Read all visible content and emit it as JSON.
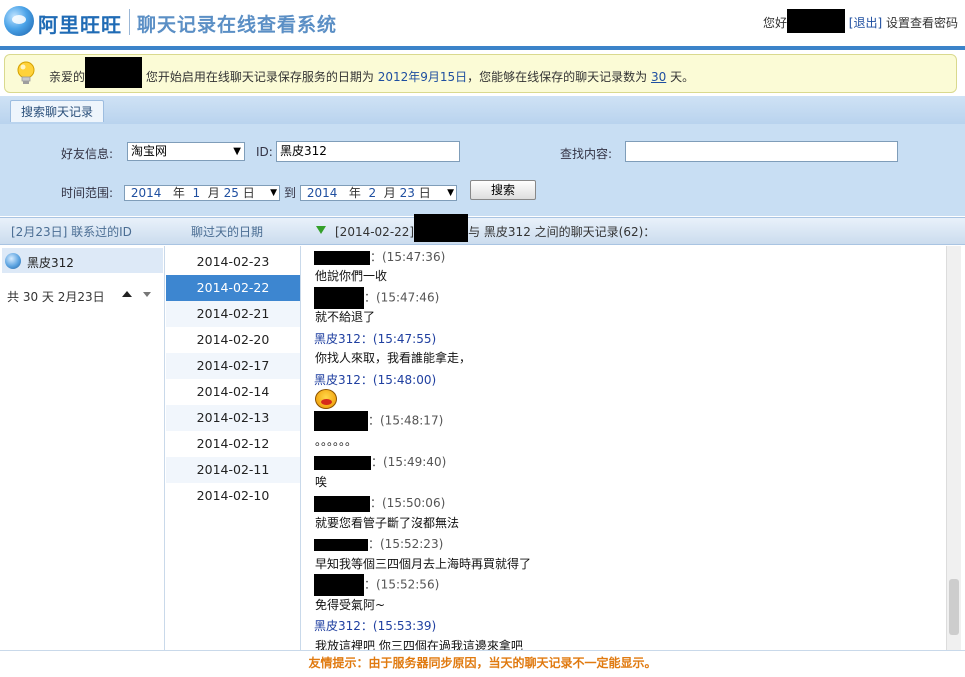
{
  "header": {
    "logo_text": "阿里旺旺",
    "system_title": "聊天记录在线查看系统",
    "greeting": "您好",
    "logout_label": "[退出]",
    "set_password_label": "设置查看密码"
  },
  "notice": {
    "prefix": "亲爱的",
    "text_a": "您开始启用在线聊天记录保存服务的日期为",
    "start_date": "2012年9月15日",
    "text_b": "，您能够在线保存的聊天记录数为",
    "days": "30",
    "text_c": "天。"
  },
  "toolbar": {
    "tab_search": "搜索聊天记录"
  },
  "form": {
    "friend_label": "好友信息:",
    "friend_select": "淘宝网",
    "id_label": "ID:",
    "id_value": "黑皮312",
    "content_label": "查找内容:",
    "content_value": "",
    "time_label": "时间范围:",
    "from": {
      "year": "2014",
      "month": "1",
      "day": "25"
    },
    "to_label": "到",
    "to": {
      "year": "2014",
      "month": "2",
      "day": "23"
    },
    "year_unit": "年",
    "month_unit": "月",
    "day_unit": "日",
    "search_button": "搜索"
  },
  "columns": {
    "contacts_title": "[2月23日] 联系过的ID",
    "dates_title": "聊过天的日期",
    "chat_title_date": "[2014-02-22]",
    "chat_title_rest": "与 黑皮312 之间的聊天记录(62)："
  },
  "contacts": {
    "name": "黑皮312",
    "count_text": "共 30 天 2月23日"
  },
  "dates": [
    "2014-02-23",
    "2014-02-22",
    "2014-02-21",
    "2014-02-20",
    "2014-02-17",
    "2014-02-14",
    "2014-02-13",
    "2014-02-12",
    "2014-02-11",
    "2014-02-10"
  ],
  "messages": [
    {
      "sender": "",
      "time": "：(15:47:36)",
      "text": "他說你們一收"
    },
    {
      "sender": "",
      "time": "：(15:47:46)",
      "text": "就不給退了"
    },
    {
      "sender": "黑皮312：",
      "time": "(15:47:55)",
      "text": "你找人來取，我看誰能拿走，"
    },
    {
      "sender": "黑皮312：",
      "time": "(15:48:00)",
      "text": ""
    },
    {
      "sender": "",
      "time": "：(15:48:17)",
      "text": "。。。。。。"
    },
    {
      "sender": "",
      "time": "：(15:49:40)",
      "text": "唉"
    },
    {
      "sender": "",
      "time": "：(15:50:06)",
      "text": "就要您看管子斷了沒都無法"
    },
    {
      "sender": "",
      "time": "：(15:52:23)",
      "text": "早知我等個三四個月去上海時再買就得了"
    },
    {
      "sender": "",
      "time": "：(15:52:56)",
      "text": "免得受氣阿~"
    },
    {
      "sender": "黑皮312：",
      "time": "(15:53:39)",
      "text": "我放這裡吧 你三四個在過我這邊來拿吧"
    }
  ],
  "footer": {
    "tip": "友情提示：由于服务器同步原因，当天的聊天记录不一定能显示。"
  }
}
